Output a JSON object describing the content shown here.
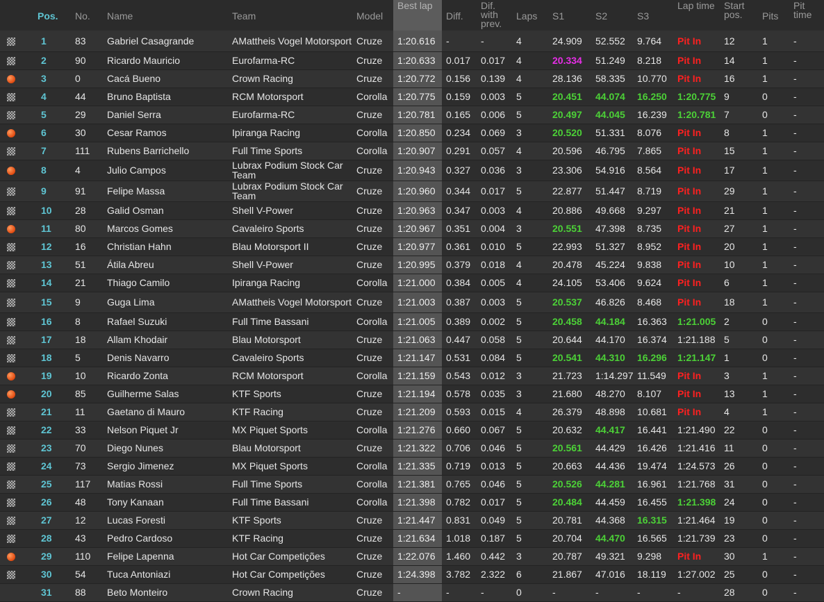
{
  "headers": {
    "pos": "Pos.",
    "no": "No.",
    "name": "Name",
    "team": "Team",
    "model": "Model",
    "best_lap": "Best lap",
    "diff": "Diff.",
    "diff_prev": "Dif. with prev.",
    "laps": "Laps",
    "s1": "S1",
    "s2": "S2",
    "s3": "S3",
    "lap_time": "Lap time",
    "start_pos": "Start pos.",
    "pits": "Pits",
    "pit_time": "Pit time"
  },
  "colors": {
    "accent": "#5fc5d3",
    "best_overall": "#4cd137",
    "best_session": "#e62ee6",
    "pit_in": "#ff2020"
  },
  "rows": [
    {
      "icon": "checkered-flag-icon",
      "pos": "1",
      "no": "83",
      "name": "Gabriel Casagrande",
      "team": "AMattheis Vogel Motorsport",
      "model": "Cruze",
      "best": "1:20.616",
      "diff": "-",
      "prev": "-",
      "laps": "4",
      "s1": "24.909",
      "s2": "52.552",
      "s3": "9.764",
      "lap": "Pit In",
      "start": "12",
      "pits": "1",
      "pit_time": "-"
    },
    {
      "icon": "checkered-flag-icon",
      "pos": "2",
      "no": "90",
      "name": "Ricardo Mauricio",
      "team": "Eurofarma-RC",
      "model": "Cruze",
      "best": "1:20.633",
      "diff": "0.017",
      "prev": "0.017",
      "laps": "4",
      "s1": "20.334",
      "s2": "51.249",
      "s3": "8.218",
      "lap": "Pit In",
      "start": "14",
      "pits": "1",
      "pit_time": "-"
    },
    {
      "icon": "orange-ball-icon",
      "pos": "3",
      "no": "0",
      "name": "Cacá Bueno",
      "team": "Crown Racing",
      "model": "Cruze",
      "best": "1:20.772",
      "diff": "0.156",
      "prev": "0.139",
      "laps": "4",
      "s1": "28.136",
      "s2": "58.335",
      "s3": "10.770",
      "lap": "Pit In",
      "start": "16",
      "pits": "1",
      "pit_time": "-"
    },
    {
      "icon": "checkered-flag-icon",
      "pos": "4",
      "no": "44",
      "name": "Bruno Baptista",
      "team": "RCM Motorsport",
      "model": "Corolla",
      "best": "1:20.775",
      "diff": "0.159",
      "prev": "0.003",
      "laps": "5",
      "s1": "20.451",
      "s2": "44.074",
      "s3": "16.250",
      "lap": "1:20.775",
      "start": "9",
      "pits": "0",
      "pit_time": "-"
    },
    {
      "icon": "checkered-flag-icon",
      "pos": "5",
      "no": "29",
      "name": "Daniel Serra",
      "team": "Eurofarma-RC",
      "model": "Cruze",
      "best": "1:20.781",
      "diff": "0.165",
      "prev": "0.006",
      "laps": "5",
      "s1": "20.497",
      "s2": "44.045",
      "s3": "16.239",
      "lap": "1:20.781",
      "start": "7",
      "pits": "0",
      "pit_time": "-"
    },
    {
      "icon": "orange-ball-icon",
      "pos": "6",
      "no": "30",
      "name": "Cesar Ramos",
      "team": "Ipiranga Racing",
      "model": "Corolla",
      "best": "1:20.850",
      "diff": "0.234",
      "prev": "0.069",
      "laps": "3",
      "s1": "20.520",
      "s2": "51.331",
      "s3": "8.076",
      "lap": "Pit In",
      "start": "8",
      "pits": "1",
      "pit_time": "-"
    },
    {
      "icon": "checkered-flag-icon",
      "pos": "7",
      "no": "111",
      "name": "Rubens Barrichello",
      "team": "Full Time Sports",
      "model": "Corolla",
      "best": "1:20.907",
      "diff": "0.291",
      "prev": "0.057",
      "laps": "4",
      "s1": "20.596",
      "s2": "46.795",
      "s3": "7.865",
      "lap": "Pit In",
      "start": "15",
      "pits": "1",
      "pit_time": "-"
    },
    {
      "icon": "orange-ball-icon",
      "pos": "8",
      "no": "4",
      "name": "Julio Campos",
      "team": "Lubrax Podium Stock Car Team",
      "model": "Cruze",
      "best": "1:20.943",
      "diff": "0.327",
      "prev": "0.036",
      "laps": "3",
      "s1": "23.306",
      "s2": "54.916",
      "s3": "8.564",
      "lap": "Pit In",
      "start": "17",
      "pits": "1",
      "pit_time": "-"
    },
    {
      "icon": "checkered-flag-icon",
      "pos": "9",
      "no": "91",
      "name": "Felipe Massa",
      "team": "Lubrax Podium Stock Car Team",
      "model": "Cruze",
      "best": "1:20.960",
      "diff": "0.344",
      "prev": "0.017",
      "laps": "5",
      "s1": "22.877",
      "s2": "51.447",
      "s3": "8.719",
      "lap": "Pit In",
      "start": "29",
      "pits": "1",
      "pit_time": "-"
    },
    {
      "icon": "checkered-flag-icon",
      "pos": "10",
      "no": "28",
      "name": "Galid Osman",
      "team": "Shell V-Power",
      "model": "Cruze",
      "best": "1:20.963",
      "diff": "0.347",
      "prev": "0.003",
      "laps": "4",
      "s1": "20.886",
      "s2": "49.668",
      "s3": "9.297",
      "lap": "Pit In",
      "start": "21",
      "pits": "1",
      "pit_time": "-"
    },
    {
      "icon": "orange-ball-icon",
      "pos": "11",
      "no": "80",
      "name": "Marcos Gomes",
      "team": "Cavaleiro Sports",
      "model": "Cruze",
      "best": "1:20.967",
      "diff": "0.351",
      "prev": "0.004",
      "laps": "3",
      "s1": "20.551",
      "s2": "47.398",
      "s3": "8.735",
      "lap": "Pit In",
      "start": "27",
      "pits": "1",
      "pit_time": "-"
    },
    {
      "icon": "checkered-flag-icon",
      "pos": "12",
      "no": "16",
      "name": "Christian Hahn",
      "team": "Blau Motorsport II",
      "model": "Cruze",
      "best": "1:20.977",
      "diff": "0.361",
      "prev": "0.010",
      "laps": "5",
      "s1": "22.993",
      "s2": "51.327",
      "s3": "8.952",
      "lap": "Pit In",
      "start": "20",
      "pits": "1",
      "pit_time": "-"
    },
    {
      "icon": "checkered-flag-icon",
      "pos": "13",
      "no": "51",
      "name": "Átila Abreu",
      "team": "Shell V-Power",
      "model": "Cruze",
      "best": "1:20.995",
      "diff": "0.379",
      "prev": "0.018",
      "laps": "4",
      "s1": "20.478",
      "s2": "45.224",
      "s3": "9.838",
      "lap": "Pit In",
      "start": "10",
      "pits": "1",
      "pit_time": "-"
    },
    {
      "icon": "checkered-flag-icon",
      "pos": "14",
      "no": "21",
      "name": "Thiago Camilo",
      "team": "Ipiranga Racing",
      "model": "Corolla",
      "best": "1:21.000",
      "diff": "0.384",
      "prev": "0.005",
      "laps": "4",
      "s1": "24.105",
      "s2": "53.406",
      "s3": "9.624",
      "lap": "Pit In",
      "start": "6",
      "pits": "1",
      "pit_time": "-"
    },
    {
      "icon": "checkered-flag-icon",
      "pos": "15",
      "no": "9",
      "name": "Guga Lima",
      "team": "AMattheis Vogel Motorsport",
      "model": "Cruze",
      "best": "1:21.003",
      "diff": "0.387",
      "prev": "0.003",
      "laps": "5",
      "s1": "20.537",
      "s2": "46.826",
      "s3": "8.468",
      "lap": "Pit In",
      "start": "18",
      "pits": "1",
      "pit_time": "-"
    },
    {
      "icon": "checkered-flag-icon",
      "pos": "16",
      "no": "8",
      "name": "Rafael Suzuki",
      "team": "Full Time Bassani",
      "model": "Corolla",
      "best": "1:21.005",
      "diff": "0.389",
      "prev": "0.002",
      "laps": "5",
      "s1": "20.458",
      "s2": "44.184",
      "s3": "16.363",
      "lap": "1:21.005",
      "start": "2",
      "pits": "0",
      "pit_time": "-"
    },
    {
      "icon": "checkered-flag-icon",
      "pos": "17",
      "no": "18",
      "name": "Allam Khodair",
      "team": "Blau Motorsport",
      "model": "Cruze",
      "best": "1:21.063",
      "diff": "0.447",
      "prev": "0.058",
      "laps": "5",
      "s1": "20.644",
      "s2": "44.170",
      "s3": "16.374",
      "lap": "1:21.188",
      "start": "5",
      "pits": "0",
      "pit_time": "-"
    },
    {
      "icon": "checkered-flag-icon",
      "pos": "18",
      "no": "5",
      "name": "Denis Navarro",
      "team": "Cavaleiro Sports",
      "model": "Cruze",
      "best": "1:21.147",
      "diff": "0.531",
      "prev": "0.084",
      "laps": "5",
      "s1": "20.541",
      "s2": "44.310",
      "s3": "16.296",
      "lap": "1:21.147",
      "start": "1",
      "pits": "0",
      "pit_time": "-"
    },
    {
      "icon": "orange-ball-icon",
      "pos": "19",
      "no": "10",
      "name": "Ricardo Zonta",
      "team": "RCM Motorsport",
      "model": "Corolla",
      "best": "1:21.159",
      "diff": "0.543",
      "prev": "0.012",
      "laps": "3",
      "s1": "21.723",
      "s2": "1:14.297",
      "s3": "11.549",
      "lap": "Pit In",
      "start": "3",
      "pits": "1",
      "pit_time": "-"
    },
    {
      "icon": "orange-ball-icon",
      "pos": "20",
      "no": "85",
      "name": "Guilherme Salas",
      "team": "KTF Sports",
      "model": "Cruze",
      "best": "1:21.194",
      "diff": "0.578",
      "prev": "0.035",
      "laps": "3",
      "s1": "21.680",
      "s2": "48.270",
      "s3": "8.107",
      "lap": "Pit In",
      "start": "13",
      "pits": "1",
      "pit_time": "-"
    },
    {
      "icon": "checkered-flag-icon",
      "pos": "21",
      "no": "11",
      "name": "Gaetano di Mauro",
      "team": "KTF Racing",
      "model": "Cruze",
      "best": "1:21.209",
      "diff": "0.593",
      "prev": "0.015",
      "laps": "4",
      "s1": "26.379",
      "s2": "48.898",
      "s3": "10.681",
      "lap": "Pit In",
      "start": "4",
      "pits": "1",
      "pit_time": "-"
    },
    {
      "icon": "checkered-flag-icon",
      "pos": "22",
      "no": "33",
      "name": "Nelson Piquet Jr",
      "team": "MX Piquet Sports",
      "model": "Corolla",
      "best": "1:21.276",
      "diff": "0.660",
      "prev": "0.067",
      "laps": "5",
      "s1": "20.632",
      "s2": "44.417",
      "s3": "16.441",
      "lap": "1:21.490",
      "start": "22",
      "pits": "0",
      "pit_time": "-"
    },
    {
      "icon": "checkered-flag-icon",
      "pos": "23",
      "no": "70",
      "name": "Diego Nunes",
      "team": "Blau Motorsport",
      "model": "Cruze",
      "best": "1:21.322",
      "diff": "0.706",
      "prev": "0.046",
      "laps": "5",
      "s1": "20.561",
      "s2": "44.429",
      "s3": "16.426",
      "lap": "1:21.416",
      "start": "11",
      "pits": "0",
      "pit_time": "-"
    },
    {
      "icon": "checkered-flag-icon",
      "pos": "24",
      "no": "73",
      "name": "Sergio Jimenez",
      "team": "MX Piquet Sports",
      "model": "Corolla",
      "best": "1:21.335",
      "diff": "0.719",
      "prev": "0.013",
      "laps": "5",
      "s1": "20.663",
      "s2": "44.436",
      "s3": "19.474",
      "lap": "1:24.573",
      "start": "26",
      "pits": "0",
      "pit_time": "-"
    },
    {
      "icon": "checkered-flag-icon",
      "pos": "25",
      "no": "117",
      "name": "Matias Rossi",
      "team": "Full Time Sports",
      "model": "Corolla",
      "best": "1:21.381",
      "diff": "0.765",
      "prev": "0.046",
      "laps": "5",
      "s1": "20.526",
      "s2": "44.281",
      "s3": "16.961",
      "lap": "1:21.768",
      "start": "31",
      "pits": "0",
      "pit_time": "-"
    },
    {
      "icon": "checkered-flag-icon",
      "pos": "26",
      "no": "48",
      "name": "Tony Kanaan",
      "team": "Full Time Bassani",
      "model": "Corolla",
      "best": "1:21.398",
      "diff": "0.782",
      "prev": "0.017",
      "laps": "5",
      "s1": "20.484",
      "s2": "44.459",
      "s3": "16.455",
      "lap": "1:21.398",
      "start": "24",
      "pits": "0",
      "pit_time": "-"
    },
    {
      "icon": "checkered-flag-icon",
      "pos": "27",
      "no": "12",
      "name": "Lucas Foresti",
      "team": "KTF Sports",
      "model": "Cruze",
      "best": "1:21.447",
      "diff": "0.831",
      "prev": "0.049",
      "laps": "5",
      "s1": "20.781",
      "s2": "44.368",
      "s3": "16.315",
      "lap": "1:21.464",
      "start": "19",
      "pits": "0",
      "pit_time": "-"
    },
    {
      "icon": "checkered-flag-icon",
      "pos": "28",
      "no": "43",
      "name": "Pedro Cardoso",
      "team": "KTF Racing",
      "model": "Cruze",
      "best": "1:21.634",
      "diff": "1.018",
      "prev": "0.187",
      "laps": "5",
      "s1": "20.704",
      "s2": "44.470",
      "s3": "16.565",
      "lap": "1:21.739",
      "start": "23",
      "pits": "0",
      "pit_time": "-"
    },
    {
      "icon": "orange-ball-icon",
      "pos": "29",
      "no": "110",
      "name": "Felipe Lapenna",
      "team": "Hot Car Competições",
      "model": "Cruze",
      "best": "1:22.076",
      "diff": "1.460",
      "prev": "0.442",
      "laps": "3",
      "s1": "20.787",
      "s2": "49.321",
      "s3": "9.298",
      "lap": "Pit In",
      "start": "30",
      "pits": "1",
      "pit_time": "-"
    },
    {
      "icon": "checkered-flag-icon",
      "pos": "30",
      "no": "54",
      "name": "Tuca Antoniazi",
      "team": "Hot Car Competições",
      "model": "Cruze",
      "best": "1:24.398",
      "diff": "3.782",
      "prev": "2.322",
      "laps": "6",
      "s1": "21.867",
      "s2": "47.016",
      "s3": "18.119",
      "lap": "1:27.002",
      "start": "25",
      "pits": "0",
      "pit_time": "-"
    },
    {
      "icon": "none",
      "pos": "31",
      "no": "88",
      "name": "Beto Monteiro",
      "team": "Crown Racing",
      "model": "Cruze",
      "best": "-",
      "diff": "-",
      "prev": "-",
      "laps": "0",
      "s1": "-",
      "s2": "-",
      "s3": "-",
      "lap": "-",
      "start": "28",
      "pits": "0",
      "pit_time": "-"
    }
  ],
  "highlights": {
    "purple": [
      "1.s1"
    ],
    "green": [
      "3.s1",
      "3.s2",
      "3.s3",
      "3.lap",
      "4.s1",
      "4.s2",
      "4.lap",
      "5.s1",
      "10.s1",
      "14.s1",
      "15.s1",
      "15.s2",
      "15.lap",
      "17.s1",
      "17.s2",
      "17.s3",
      "17.lap",
      "21.s2",
      "22.s1",
      "24.s1",
      "24.s2",
      "25.s1",
      "25.lap",
      "26.s3",
      "27.s2"
    ]
  }
}
